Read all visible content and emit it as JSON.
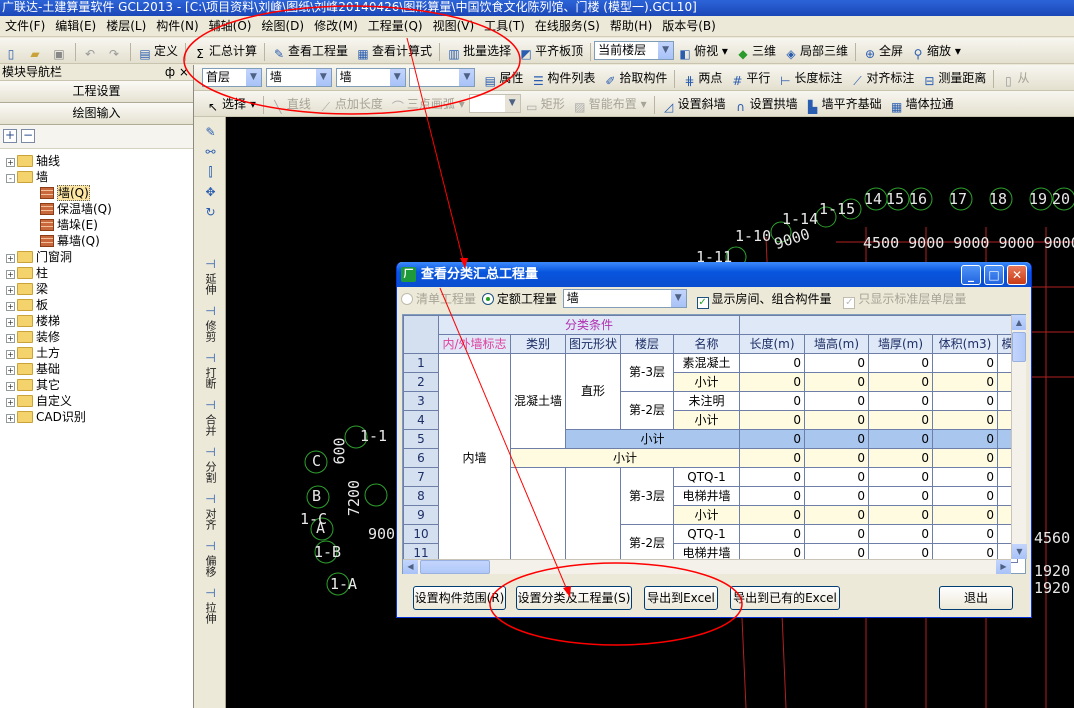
{
  "window": {
    "title": "广联达-土建算量软件 GCL2013 - [C:\\项目资料\\刘峰\\图纸\\刘峰20140426\\图形算量\\中国饮食文化陈列馆、门楼 (模型一).GCL10]"
  },
  "menu": [
    "文件(F)",
    "编辑(E)",
    "楼层(L)",
    "构件(N)",
    "辅轴(O)",
    "绘图(D)",
    "修改(M)",
    "工程量(Q)",
    "视图(V)",
    "工具(T)",
    "在线服务(S)",
    "帮助(H)",
    "版本号(B)"
  ],
  "toolbar1": {
    "define": "定义",
    "summary": "汇总计算",
    "view_qty": "查看工程量",
    "view_formula": "查看计算式",
    "batch_select": "批量选择",
    "align_slab": "平齐板顶",
    "current_floor": "当前楼层",
    "top_view": "俯视",
    "three_d": "三维",
    "local_3d": "局部三维",
    "fullscreen": "全屏",
    "zoom": "缩放"
  },
  "toolbar2": {
    "floor": "首层",
    "type": "墙",
    "name": "墙",
    "blank": "",
    "props": "属性",
    "list": "构件列表",
    "pick": "拾取构件",
    "two_points": "两点",
    "parallel": "平行",
    "length_dim": "长度标注",
    "align_dim": "对齐标注",
    "measure": "测量距离",
    "from": "从"
  },
  "toolbar3": {
    "select": "选择",
    "line": "直线",
    "point_add_len": "点加长度",
    "three_arc": "三点画弧",
    "rect": "矩形",
    "smart": "智能布置",
    "slant_wall": "设置斜墙",
    "arch_wall": "设置拱墙",
    "wall_base": "墙平齐基础",
    "wall_stretch": "墙体拉通"
  },
  "left_panel": {
    "title": "模块导航栏",
    "pin": "ф ×",
    "btn_project": "工程设置",
    "btn_draw": "绘图输入",
    "tree": [
      {
        "label": "轴线",
        "level": 0,
        "expand": "+"
      },
      {
        "label": "墙",
        "level": 0,
        "expand": "-"
      },
      {
        "label": "墙(Q)",
        "level": 1,
        "expand": ""
      },
      {
        "label": "保温墙(Q)",
        "level": 1,
        "expand": ""
      },
      {
        "label": "墙垛(E)",
        "level": 1,
        "expand": ""
      },
      {
        "label": "幕墙(Q)",
        "level": 1,
        "expand": ""
      },
      {
        "label": "门窗洞",
        "level": 0,
        "expand": "+"
      },
      {
        "label": "柱",
        "level": 0,
        "expand": "+"
      },
      {
        "label": "梁",
        "level": 0,
        "expand": "+"
      },
      {
        "label": "板",
        "level": 0,
        "expand": "+"
      },
      {
        "label": "楼梯",
        "level": 0,
        "expand": "+"
      },
      {
        "label": "装修",
        "level": 0,
        "expand": "+"
      },
      {
        "label": "土方",
        "level": 0,
        "expand": "+"
      },
      {
        "label": "基础",
        "level": 0,
        "expand": "+"
      },
      {
        "label": "其它",
        "level": 0,
        "expand": "+"
      },
      {
        "label": "自定义",
        "level": 0,
        "expand": "+"
      },
      {
        "label": "CAD识别",
        "level": 0,
        "expand": "+"
      }
    ]
  },
  "vtools": [
    "延伸",
    "修剪",
    "打断",
    "合并",
    "分割",
    "对齐",
    "偏移",
    "拉伸"
  ],
  "dialog": {
    "title": "查看分类汇总工程量",
    "radio_list": "清单工程量",
    "radio_quota": "定额工程量",
    "combo": "墙",
    "chk_rooms": "显示房间、组合构件量",
    "chk_std": "只显示标准层单层量",
    "head_group": "分类条件",
    "headers": [
      "内/外墙标志",
      "类别",
      "图元形状",
      "楼层",
      "名称",
      "长度(m)",
      "墙高(m)",
      "墙厚(m)",
      "体积(m3)",
      "模"
    ],
    "inner_wall": "内墙",
    "concrete_wall": "混凝土墙",
    "straight": "直形",
    "straight2": "直形",
    "floor_m3": "第-3层",
    "floor_m2": "第-2层",
    "floor_m3b": "第-3层",
    "floor_m2b": "第-2层",
    "rows": [
      {
        "n": "1",
        "name": "素混凝土",
        "v": [
          "0",
          "0",
          "0",
          "0"
        ]
      },
      {
        "n": "2",
        "name": "小计",
        "v": [
          "0",
          "0",
          "0",
          "0"
        ]
      },
      {
        "n": "3",
        "name": "未注明",
        "v": [
          "0",
          "0",
          "0",
          "0"
        ]
      },
      {
        "n": "4",
        "name": "小计",
        "v": [
          "0",
          "0",
          "0",
          "0"
        ]
      },
      {
        "n": "5",
        "name": "小计",
        "v": [
          "0",
          "0",
          "0",
          "0"
        ]
      },
      {
        "n": "6",
        "name": "小计",
        "v": [
          "0",
          "0",
          "0",
          "0"
        ]
      },
      {
        "n": "7",
        "name": "QTQ-1",
        "v": [
          "0",
          "0",
          "0",
          "0"
        ]
      },
      {
        "n": "8",
        "name": "电梯井墙",
        "v": [
          "0",
          "0",
          "0",
          "0"
        ]
      },
      {
        "n": "9",
        "name": "小计",
        "v": [
          "0",
          "0",
          "0",
          "0"
        ]
      },
      {
        "n": "10",
        "name": "QTQ-1",
        "v": [
          "0",
          "0",
          "0",
          "0"
        ]
      },
      {
        "n": "11",
        "name": "电梯井墙",
        "v": [
          "0",
          "0",
          "0",
          "0"
        ]
      }
    ],
    "btn_range": "设置构件范围(R)",
    "btn_class": "设置分类及工程量(S)",
    "btn_export": "导出到Excel",
    "btn_export_existing": "导出到已有的Excel",
    "btn_exit": "退出"
  },
  "cad": {
    "labels_top": [
      "14",
      "15",
      "16",
      "17",
      "18",
      "19",
      "20"
    ],
    "axis_nums": "4500 9000 9000 9000 9000",
    "left_labels": [
      "C",
      "B",
      "A",
      "1-C",
      "1-B",
      "1-A",
      "1-1",
      "1-14",
      "1-15",
      "1-11",
      "1-10"
    ],
    "dims": [
      "600",
      "7200",
      "900",
      "9000"
    ],
    "right_labels": [
      "4560",
      "1920",
      "1920"
    ]
  },
  "accent": "#ff0000"
}
